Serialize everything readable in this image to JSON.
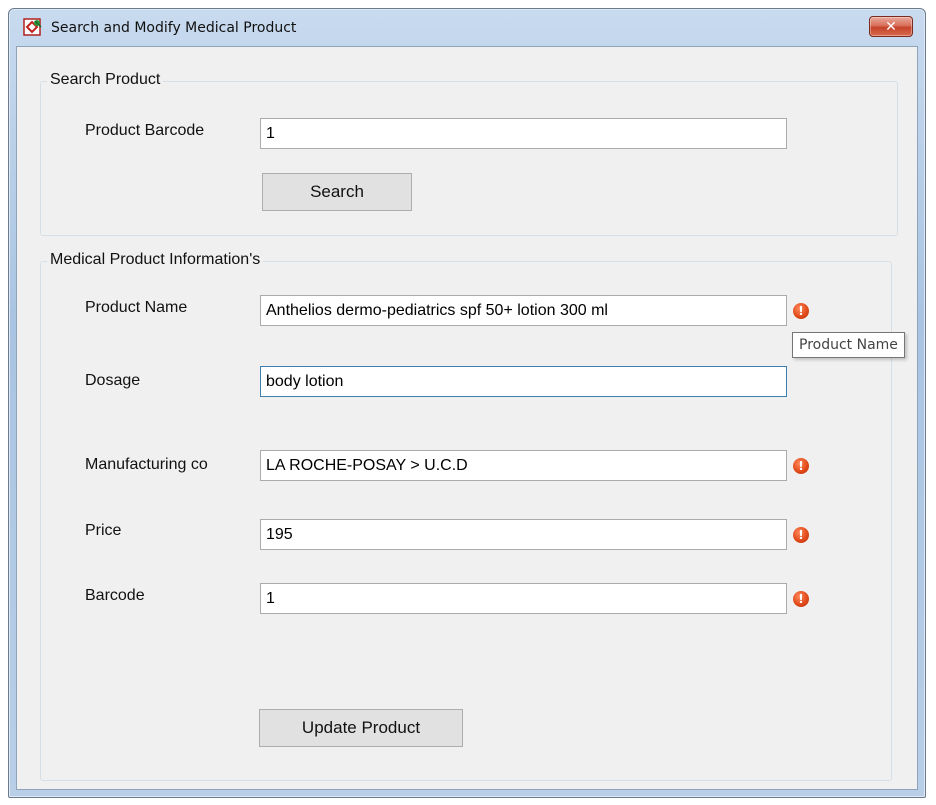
{
  "window": {
    "title": "Search and Modify Medical Product",
    "close_label": "✕"
  },
  "search_group": {
    "title": "Search Product",
    "barcode_label": "Product Barcode",
    "barcode_value": "1",
    "search_button": "Search"
  },
  "info_group": {
    "title": "Medical Product Information's",
    "fields": {
      "product_name": {
        "label": "Product Name",
        "value": "Anthelios dermo-pediatrics spf 50+ lotion 300 ml",
        "has_error": true
      },
      "dosage": {
        "label": "Dosage",
        "value": "body lotion",
        "has_error": false
      },
      "manufacturing_co": {
        "label": "Manufacturing co",
        "value": "LA ROCHE-POSAY > U.C.D",
        "has_error": true
      },
      "price": {
        "label": "Price",
        "value": "195",
        "has_error": true
      },
      "barcode": {
        "label": "Barcode",
        "value": "1",
        "has_error": true
      }
    },
    "update_button": "Update Product"
  },
  "tooltip": {
    "text": "Product Name"
  },
  "icons": {
    "error": "error-exclamation-icon",
    "app": "app-icon",
    "close": "close-icon"
  },
  "colors": {
    "error_icon": "#e24a1a",
    "close_button": "#c5432a",
    "focus_border": "#3c7fb1"
  }
}
